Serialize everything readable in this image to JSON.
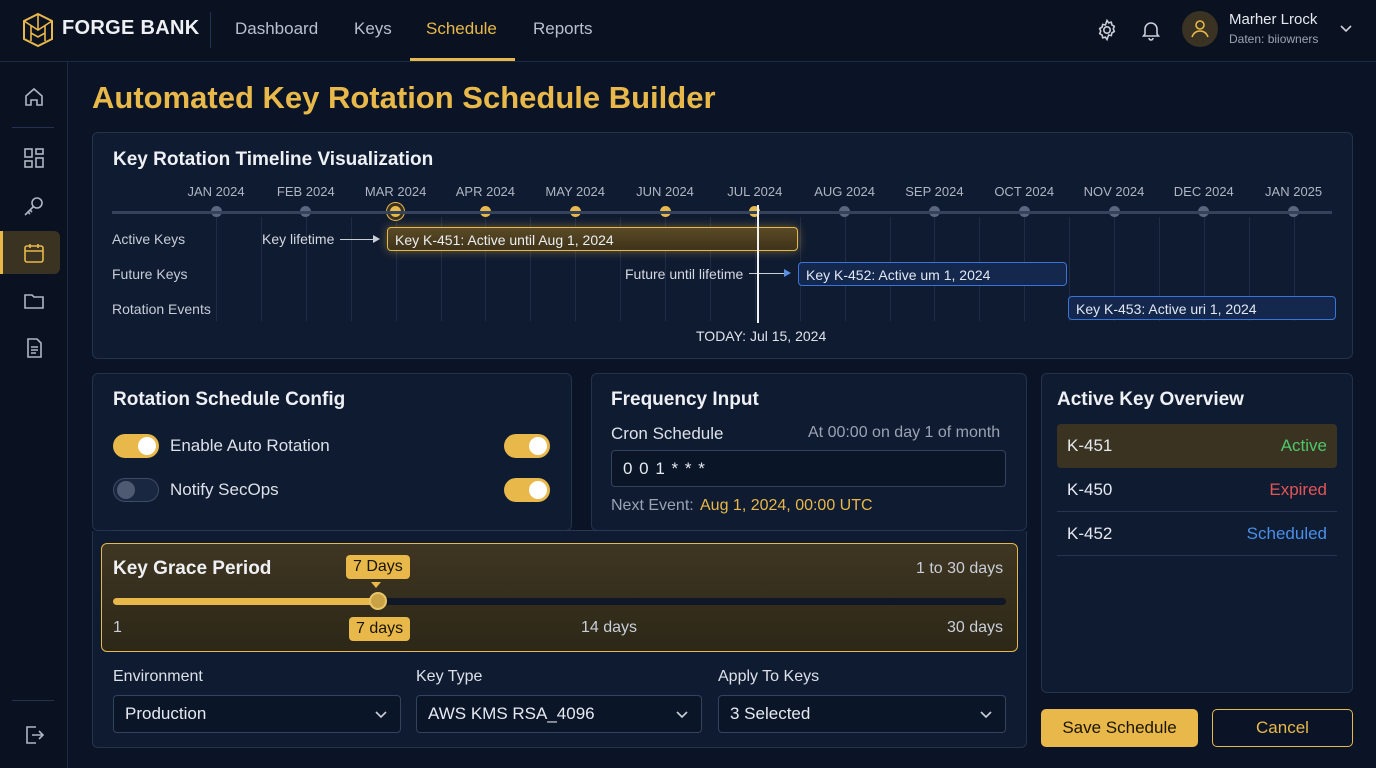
{
  "app": {
    "name": "FORGE BANK"
  },
  "nav": {
    "dashboard": "Dashboard",
    "keys": "Keys",
    "schedule": "Schedule",
    "reports": "Reports"
  },
  "user": {
    "name": "Marher Lrock",
    "subtitle": "Daten: biiowners"
  },
  "page": {
    "title": "Automated Key Rotation Schedule Builder"
  },
  "timeline": {
    "title": "Key Rotation Timeline Visualization",
    "months": [
      "JAN 2024",
      "FEB 2024",
      "MAR 2024",
      "APR 2024",
      "MAY 2024",
      "JUN 2024",
      "JUL 2024",
      "AUG 2024",
      "SEP 2024",
      "OCT 2024",
      "NOV 2024",
      "DEC 2024",
      "JAN 2025"
    ],
    "rows": {
      "active": "Active Keys",
      "future": "Future Keys",
      "events": "Rotation Events"
    },
    "note_lifetime": "Key lifetime",
    "note_future": "Future until lifetime",
    "bar_active": "Key K-451: Active until Aug 1, 2024",
    "bar_future": "Key K-452: Active um 1, 2024",
    "bar_event": "Key K-453: Active uri 1, 2024",
    "today": "TODAY: Jul 15, 2024"
  },
  "config": {
    "title": "Rotation Schedule Config",
    "auto_rotation": "Enable Auto Rotation",
    "notify": "Notify SecOps"
  },
  "frequency": {
    "title": "Frequency Input",
    "cron_label": "Cron Schedule",
    "cron_hint": "At 00:00 on day 1 of month",
    "cron_value": "0 0 1 * * *",
    "next_label": "Next Event:",
    "next_value": "Aug 1, 2024, 00:00 UTC"
  },
  "grace": {
    "title": "Key Grace Period",
    "bubble": "7 Days",
    "range_hint": "1 to 30 days",
    "min": "1",
    "current": "7 days",
    "mid": "14 days",
    "max": "30 days",
    "value_days": 7
  },
  "fields": {
    "environment_label": "Environment",
    "environment_value": "Production",
    "keytype_label": "Key Type",
    "keytype_value": "AWS KMS RSA_4096",
    "apply_label": "Apply To Keys",
    "apply_value": "3 Selected"
  },
  "overview": {
    "title": "Active Key Overview",
    "keys": [
      {
        "id": "K-451",
        "status": "Active",
        "color": "#4ec66a"
      },
      {
        "id": "K-450",
        "status": "Expired",
        "color": "#e25555"
      },
      {
        "id": "K-452",
        "status": "Scheduled",
        "color": "#4a8fe8"
      }
    ]
  },
  "actions": {
    "save": "Save Schedule",
    "cancel": "Cancel"
  },
  "colors": {
    "accent": "#e8b84a",
    "background": "#0b1426",
    "panel": "#0f1b31"
  }
}
